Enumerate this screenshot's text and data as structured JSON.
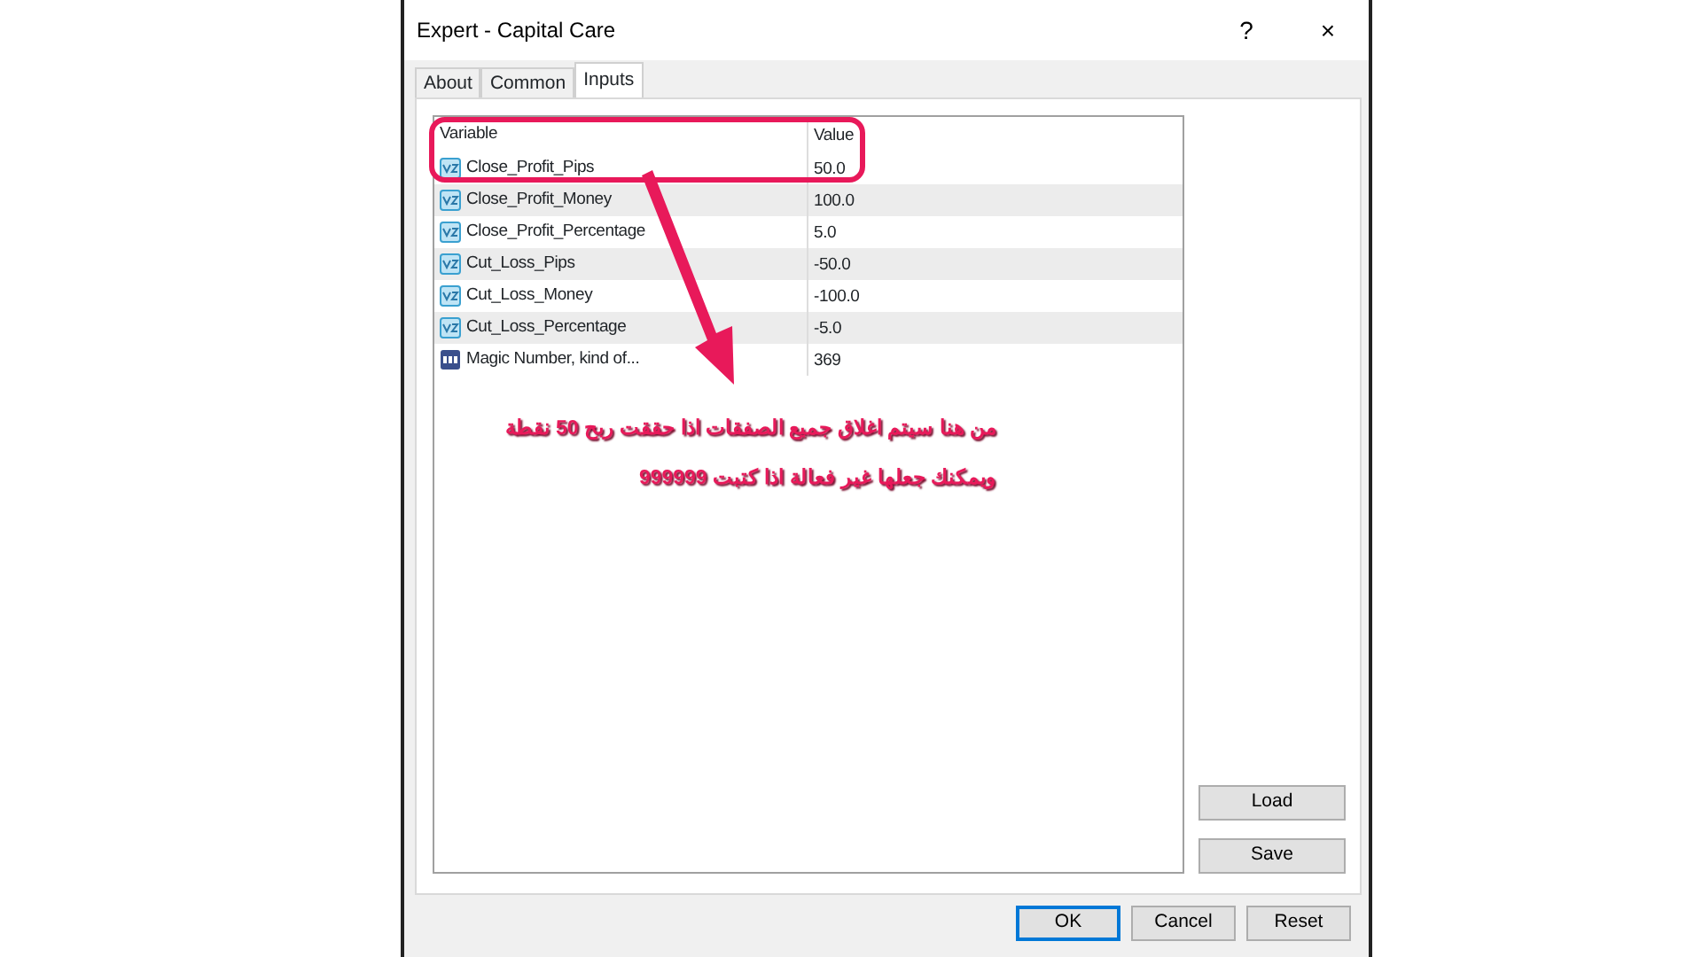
{
  "window": {
    "title": "Expert - Capital Care",
    "help": "?",
    "close": "×"
  },
  "tabs": [
    {
      "label": "About",
      "selected": false
    },
    {
      "label": "Common",
      "selected": false
    },
    {
      "label": "Inputs",
      "selected": true
    }
  ],
  "table": {
    "columns": [
      "Variable",
      "Value"
    ],
    "rows": [
      {
        "kind": "double",
        "variable": "Close_Profit_Pips",
        "value": "50.0"
      },
      {
        "kind": "double",
        "variable": "Close_Profit_Money",
        "value": "100.0"
      },
      {
        "kind": "double",
        "variable": "Close_Profit_Percentage",
        "value": "5.0"
      },
      {
        "kind": "double",
        "variable": "Cut_Loss_Pips",
        "value": "-50.0"
      },
      {
        "kind": "double",
        "variable": "Cut_Loss_Money",
        "value": "-100.0"
      },
      {
        "kind": "double",
        "variable": "Cut_Loss_Percentage",
        "value": "-5.0"
      },
      {
        "kind": "integer",
        "variable": "Magic Number, kind of...",
        "value": "369"
      }
    ]
  },
  "annotation": {
    "lines": [
      "من هنا سيتم اغلاق جميع الصفقات اذا حققت ربح 50 نقطة",
      "ويمكنك جعلها غير فعالة اذا كتبت 999999"
    ]
  },
  "side_buttons": [
    "Load",
    "Save"
  ],
  "footer_buttons": [
    {
      "label": "OK",
      "default": true
    },
    {
      "label": "Cancel",
      "default": false
    },
    {
      "label": "Reset",
      "default": false
    }
  ]
}
